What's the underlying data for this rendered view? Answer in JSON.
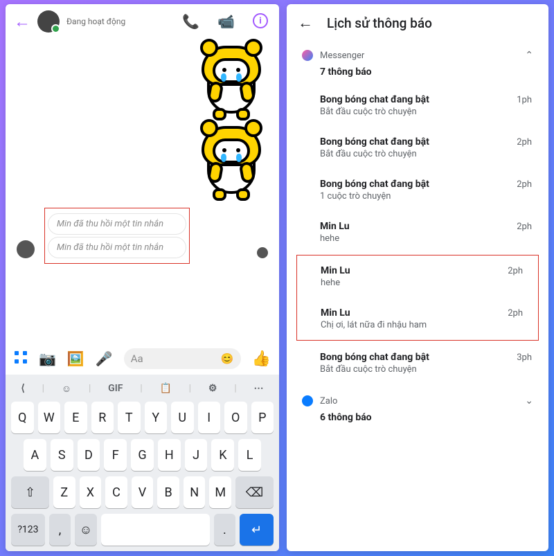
{
  "left": {
    "status": "Đang hoạt động",
    "recalled1": "Min đã thu hồi một tin nhắn",
    "recalled2": "Min đã thu hồi một tin nhắn",
    "composer_placeholder": "Aa",
    "toolbar": {
      "gif": "GIF"
    },
    "keys": {
      "row1": [
        "Q",
        "W",
        "E",
        "R",
        "T",
        "Y",
        "U",
        "I",
        "O",
        "P"
      ],
      "row2": [
        "A",
        "S",
        "D",
        "F",
        "G",
        "H",
        "J",
        "K",
        "L"
      ],
      "row3": [
        "Z",
        "X",
        "C",
        "V",
        "B",
        "N",
        "M"
      ],
      "sym": "?123",
      "comma": ",",
      "period": "."
    }
  },
  "right": {
    "title": "Lịch sử thông báo",
    "app1": {
      "name": "Messenger",
      "count": "7 thông báo"
    },
    "app2": {
      "name": "Zalo",
      "count": "6 thông báo"
    },
    "n": [
      {
        "t": "Bong bóng chat đang bật",
        "s": "Bắt đầu cuộc trò chuyện",
        "time": "1ph"
      },
      {
        "t": "Bong bóng chat đang bật",
        "s": "Bắt đầu cuộc trò chuyện",
        "time": "2ph"
      },
      {
        "t": "Bong bóng chat đang bật",
        "s": "1 cuộc trò chuyện",
        "time": "2ph"
      },
      {
        "t": "Min Lu",
        "s": "hehe",
        "time": "2ph"
      },
      {
        "t": "Min Lu",
        "s": "hehe",
        "time": "2ph"
      },
      {
        "t": "Min Lu",
        "s": "Chị ơi, lát nữa đi nhậu ham",
        "time": "2ph"
      },
      {
        "t": "Bong bóng chat đang bật",
        "s": "Bắt đầu cuộc trò chuyện",
        "time": "3ph"
      }
    ]
  }
}
